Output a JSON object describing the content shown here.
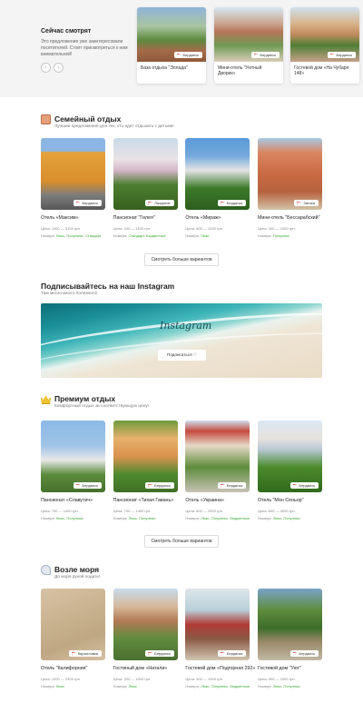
{
  "watching": {
    "title": "Сейчас смотрят",
    "description": "Это предложение уже заинтересовали посетителей. Стоит присмотреться к ним внимательней!",
    "prev_icon": "chevron-left-icon",
    "next_icon": "chevron-right-icon",
    "cards": [
      {
        "name": "База отдыха \"Эллада\"",
        "city": "Бердянск"
      },
      {
        "name": "Мини-отель \"Уютный Дворик»",
        "city": "Бердянск"
      },
      {
        "name": "Гостевой дом «На Чубаря 148»",
        "city": "Бердянск"
      }
    ]
  },
  "family": {
    "title": "Семейный отдых",
    "subtitle": "Лучшие предложения для тех, кто едет отдыхать с детьми!",
    "cards": [
      {
        "name": "Отель «Максим»",
        "city": "Бердянск",
        "price": "Цена: 1000 — 3100 грн.",
        "rooms_label": "Номера:",
        "rooms": "Люкс, Полулюкс, Стандарт"
      },
      {
        "name": "Пансионат \"Гилея\"",
        "city": "Лазурное",
        "price": "Цена: 400 — 1100 грн.",
        "rooms_label": "Номера:",
        "rooms": "Стандарт, Бюджетные"
      },
      {
        "name": "Отель «Мираж»",
        "city": "Бердянск",
        "price": "Цена: 800 — 1040 грн.",
        "rooms_label": "Номера:",
        "rooms": "Люкс"
      },
      {
        "name": "Мини-отель \"Бессарабский\"",
        "city": "Затока",
        "price": "Цена: 300 — 1000 грн.",
        "rooms_label": "Номера:",
        "rooms": "Полулюкс"
      }
    ],
    "more_label": "Смотреть больше вариантов"
  },
  "instagram": {
    "title": "Подписывайтесь на наш Instagram",
    "subtitle": "Там много-много полезного!",
    "brand_word": "Instagram",
    "subscribe_label": "Подписаться ♡"
  },
  "premium": {
    "title": "Премиум отдых",
    "subtitle": "Комфортный отдых за соответствующую цену!",
    "cards": [
      {
        "name": "Пансионат «Славутич»",
        "city": "Бердянск",
        "price": "Цена: 700 — 1400 грн.",
        "rooms_label": "Номера:",
        "rooms": "Люкс, Полулюкс"
      },
      {
        "name": "Пансионат «Тихая Гавань»",
        "city": "Бердянск",
        "price": "Цена: 700 — 1400 грн.",
        "rooms_label": "Номера:",
        "rooms": "Люкс, Полулюкс"
      },
      {
        "name": "Отель «Украина»",
        "city": "Бердянск",
        "price": "Цена: 800 — 2500 грн.",
        "rooms_label": "Номера:",
        "rooms": "Люкс, Полулюкс, Бюджетные"
      },
      {
        "name": "Отель \"Мон Сеньор\"",
        "city": "Бердянск",
        "price": "Цена: 800 — 4000 грн.",
        "rooms_label": "Номера:",
        "rooms": "Люкс, Полулюкс"
      }
    ],
    "more_label": "Смотреть больше вариантов"
  },
  "sea": {
    "title": "Возле моря",
    "subtitle": "До моря рукой подать!",
    "cards": [
      {
        "name": "Отель \"Калифорния\"",
        "city": "Кирилловка",
        "price": "Цена: 1000 — 2300 грн.",
        "rooms_label": "Номера:",
        "rooms": "Люкс"
      },
      {
        "name": "Гостиный дом «Натали»",
        "city": "Бердянск",
        "price": "Цена: 300 — 1000 грн.",
        "rooms_label": "Номера:",
        "rooms": "Люкс"
      },
      {
        "name": "Гостевой дом «Подгорная 292»",
        "city": "Бердянск",
        "price": "Цена: 300 — 1000 грн.",
        "rooms_label": "Номера:",
        "rooms": "Люкс, Полулюкс, Бюджетные"
      },
      {
        "name": "Гостевой дом \"Уют\"",
        "city": "Бердянск",
        "price": "Цена: 300 — 1000 грн.",
        "rooms_label": "Номера:",
        "rooms": "Люкс, Полулюкс"
      }
    ]
  }
}
